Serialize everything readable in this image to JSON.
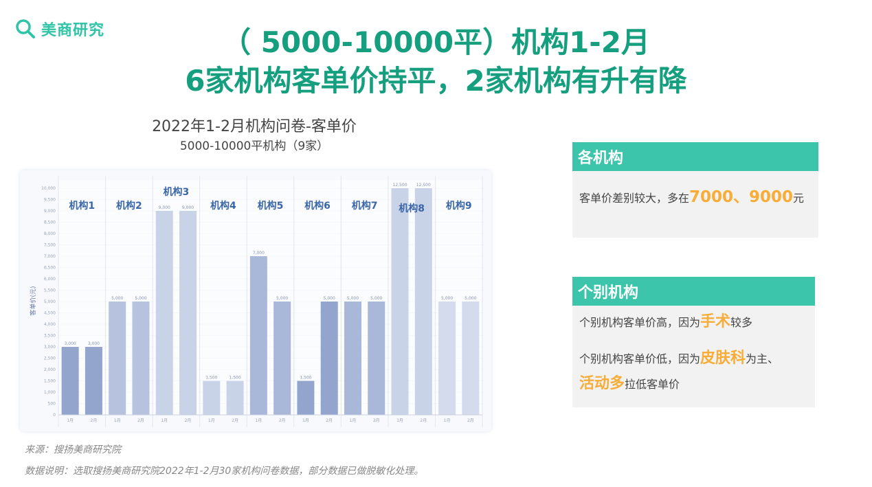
{
  "brand": {
    "name": "美商研究",
    "icon": "magnifier-icon",
    "color": "#2fc4a6"
  },
  "header": {
    "title_line1": "（ 5000-10000平）机构1-2月",
    "title_line2": "6家机构客单价持平，2家机构有升有降"
  },
  "chart_data": {
    "type": "bar",
    "title": "2022年1-2月机构问卷-客单价",
    "subtitle": "5000-10000平机构（9家）",
    "ylabel": "客单价(元)",
    "ylim": [
      0,
      10000
    ],
    "y_ticks": [
      0,
      500,
      1000,
      1500,
      2000,
      2500,
      3000,
      3500,
      4000,
      4500,
      5000,
      5500,
      6000,
      6500,
      7000,
      7500,
      8000,
      8500,
      9000,
      9500,
      10000
    ],
    "y_tick_labels": [
      "0",
      "500",
      "1,000",
      "1,500",
      "2,000",
      "2,500",
      "3,000",
      "3,500",
      "4,000",
      "4,500",
      "5,000",
      "5,500",
      "6,000",
      "6,500",
      "7,000",
      "7,500",
      "8,000",
      "8,500",
      "9,000",
      "9,500",
      "10,000"
    ],
    "month_labels": [
      "1月",
      "2月"
    ],
    "grid": true,
    "groups": [
      {
        "name": "机构1",
        "values": [
          3000,
          3000
        ],
        "labels": [
          "3,000",
          "3,000"
        ],
        "color": "#93a5cc"
      },
      {
        "name": "机构2",
        "values": [
          5000,
          5000
        ],
        "labels": [
          "5,000",
          "5,000"
        ],
        "color": "#b7c3de"
      },
      {
        "name": "机构3",
        "values": [
          9000,
          9000
        ],
        "labels": [
          "9,000",
          "9,000"
        ],
        "color": "#c9d3e8"
      },
      {
        "name": "机构4",
        "values": [
          1500,
          1500
        ],
        "labels": [
          "1,500",
          "1,500"
        ],
        "color": "#c9d3e8"
      },
      {
        "name": "机构5",
        "values": [
          7000,
          5000
        ],
        "labels": [
          "7,000",
          "5,000"
        ],
        "color": "#a9b7d9"
      },
      {
        "name": "机构6",
        "values": [
          1500,
          5000
        ],
        "labels": [
          "1,500",
          "5,000"
        ],
        "color": "#93a5cc"
      },
      {
        "name": "机构7",
        "values": [
          5000,
          5000
        ],
        "labels": [
          "5,000",
          "5,000"
        ],
        "color": "#a9b7d9"
      },
      {
        "name": "机构8",
        "values": [
          12500,
          12500
        ],
        "labels": [
          "12,500",
          "12,500"
        ],
        "color": "#c9d3e8"
      },
      {
        "name": "机构9",
        "values": [
          5000,
          5000
        ],
        "labels": [
          "5,000",
          "5,000"
        ],
        "color": "#d3dbed"
      }
    ]
  },
  "panel1": {
    "header": "各机构",
    "text_before": "客单价差别较大，多在",
    "hl1": "7000",
    "sep": "、",
    "hl2": "9000",
    "text_after": "元"
  },
  "panel2": {
    "header": "个别机构",
    "line1_before": "个别机构客单价高，因为",
    "line1_hl": "手术",
    "line1_after": "较多",
    "line2_before": "个别机构客单价低，因为",
    "line2_hl1": "皮肤科",
    "line2_mid": "为主、",
    "line2_hl2": "活动多",
    "line2_after": "拉低客单价"
  },
  "footer": {
    "source": "来源：搜扬美商研究院",
    "note": "数据说明：选取搜扬美商研究院2022年1-2月30家机构问卷数据，部分数据已做脱敏化处理。"
  },
  "colors": {
    "title": "#169f7e",
    "panel_header": "#3cc5aa",
    "highlight": "#f7ad37",
    "label": "#3a66a8"
  }
}
